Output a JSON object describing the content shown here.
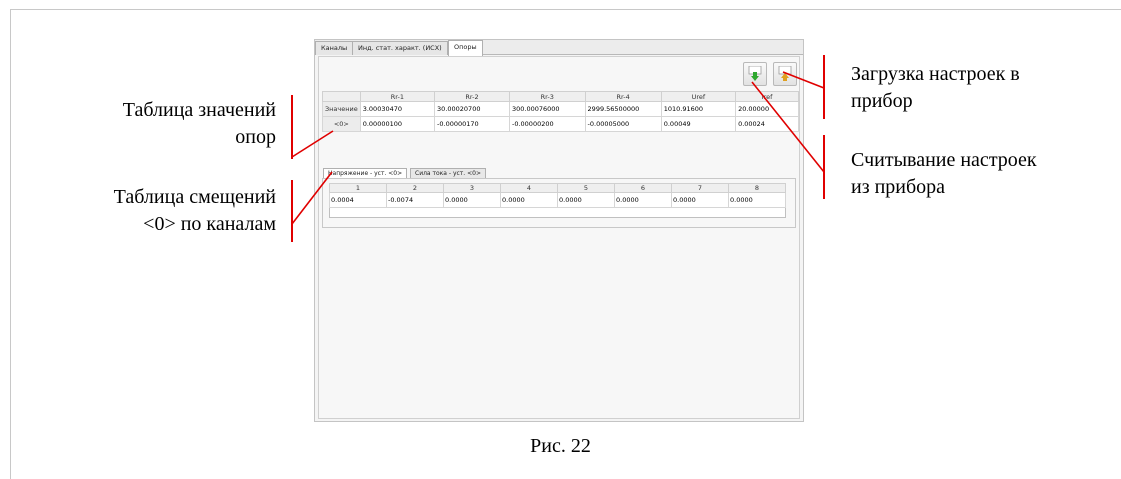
{
  "tabs": [
    "Каналы",
    "Инд. стат. характ. (ИСХ)",
    "Опоры"
  ],
  "active_tab": "Опоры",
  "toolbar": {
    "upload_icon": "download-arrow-icon",
    "read_icon": "upload-arrow-icon"
  },
  "supports_table": {
    "headers": [
      "Rr-1",
      "Rr-2",
      "Rr-3",
      "Rr-4",
      "Uref",
      "Iref"
    ],
    "rows": [
      {
        "label": "Значение",
        "cells": [
          "3.00030470",
          "30.00020700",
          "300.00076000",
          "2999.56500000",
          "1010.91600",
          "20.00000"
        ]
      },
      {
        "label": "<0>",
        "cells": [
          "0.00000100",
          "-0.00000170",
          "-0.00000200",
          "-0.00005000",
          "0.00049",
          "0.00024"
        ]
      }
    ]
  },
  "sub_tabs": [
    "Напряжение - уст. <0>",
    "Сила тока - уст. <0>"
  ],
  "offsets_table": {
    "headers": [
      "1",
      "2",
      "3",
      "4",
      "5",
      "6",
      "7",
      "8"
    ],
    "values": [
      "0.0004",
      "-0.0074",
      "0.0000",
      "0.0000",
      "0.0000",
      "0.0000",
      "0.0000",
      "0.0000"
    ]
  },
  "annotations": {
    "supports_line1": "Таблица  значений",
    "supports_line2": "опор",
    "offsets_line1": "Таблица смещений",
    "offsets_line2": "<0> по каналам",
    "load_line1": "Загрузка настроек в",
    "load_line2": "прибор",
    "read_line1": "Считывание настроек",
    "read_line2": "из прибора"
  },
  "caption": "Рис. 22",
  "colors": {
    "annotation_line": "#e00000",
    "download_arrow": "#2fa82f",
    "upload_arrow": "#e0a020"
  }
}
